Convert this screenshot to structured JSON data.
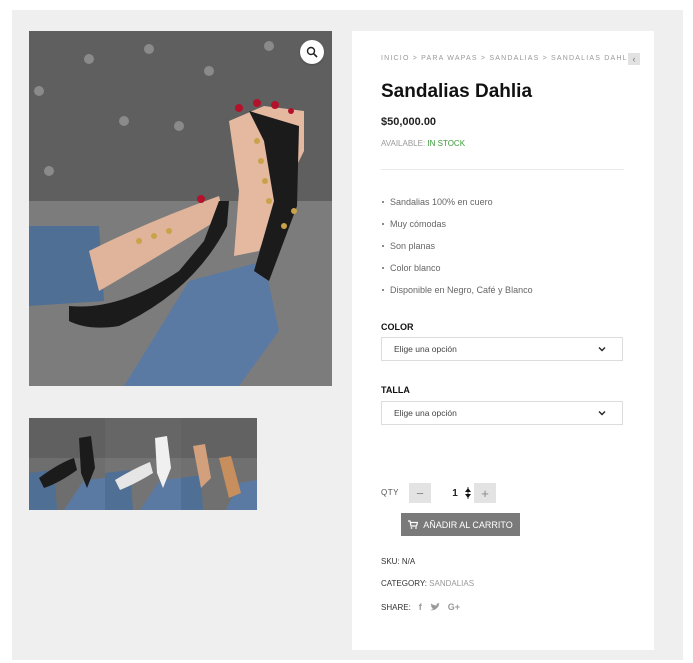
{
  "gallery": {
    "zoom_icon": "magnifier-icon",
    "thumbnails": [
      "black",
      "white",
      "tan"
    ]
  },
  "product": {
    "breadcrumb": "INICIO > PARA WAPAS > SANDALIAS > SANDALIAS DAHLIA",
    "title": "Sandalias Dahlia",
    "price": "$50,000.00",
    "available_label": "AVAILABLE:",
    "available_value": "IN STOCK",
    "features": [
      "Sandalias 100% en cuero",
      "Muy cómodas",
      "Son planas",
      "Color blanco",
      "Disponible en Negro, Café y Blanco"
    ],
    "color_label": "COLOR",
    "color_select": "Elige una opción",
    "talla_label": "TALLA",
    "talla_select": "Elige una opción",
    "qty_label": "QTY",
    "qty_minus": "−",
    "qty_value": "1",
    "qty_plus": "+",
    "add_to_cart": "AÑADIR AL CARRITO",
    "sku_label": "SKU:",
    "sku_value": "N/A",
    "category_label": "CATEGORY:",
    "category_value": "SANDALIAS",
    "share_label": "SHARE:",
    "share_facebook": "f",
    "share_twitter": "t",
    "share_gplus": "G+"
  },
  "colors": {
    "in_stock": "#3b9c3b",
    "cart_button": "#7a7a7a"
  }
}
